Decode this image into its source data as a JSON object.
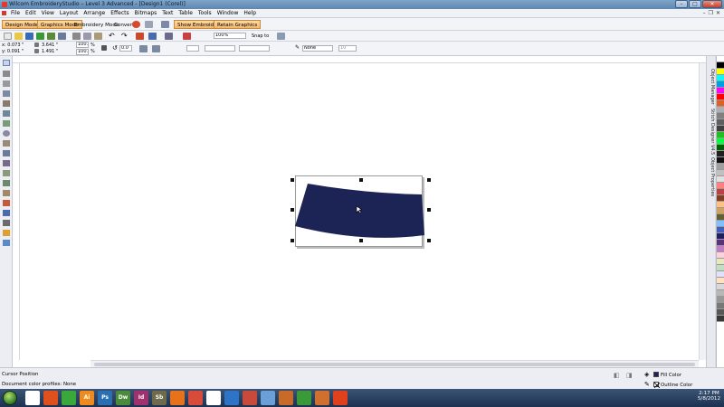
{
  "window": {
    "title": "Wilcom EmbroideryStudio – Level 3 Advanced - [Design1 (Corel)]"
  },
  "menu": {
    "items": [
      "File",
      "Edit",
      "View",
      "Layout",
      "Arrange",
      "Effects",
      "Bitmaps",
      "Text",
      "Table",
      "Tools",
      "Window",
      "Help"
    ]
  },
  "toolbar": {
    "design_mode": "Design Mode",
    "graphics_mode": "Graphics Mode",
    "embroidery_mode": "Embroidery Mode",
    "convert": "Convert",
    "show_embroidery": "Show Embroidery",
    "retain_graphics": "Retain Graphics"
  },
  "standard_toolbar": {
    "zoom": "100%",
    "snap_to": "Snap to"
  },
  "property_bar": {
    "x": "x: 0.073 \"",
    "y": "y: 0.091 \"",
    "width": "3.641 \"",
    "height": "1.491 \"",
    "scale_x": "100.0",
    "scale_y": "100.0",
    "percent": "%",
    "angle": "0.0",
    "outline": "None",
    "outline_size": "10"
  },
  "docker": {
    "tab1": "Object Manager",
    "tab2": "Stitch Designer V4.5",
    "tab3": "Object Properties"
  },
  "palette_colors": [
    "#ffffff",
    "#000000",
    "#ffff00",
    "#00ffff",
    "#00a0e0",
    "#ff00ff",
    "#ff0000",
    "#e06020",
    "#b0b0b0",
    "#808080",
    "#606060",
    "#404040",
    "#20c020",
    "#00ff40",
    "#006000",
    "#202020",
    "#101010",
    "#a0a0a0",
    "#c0c0c0",
    "#e0e0e0",
    "#ff8080",
    "#c04040",
    "#804020",
    "#ffc080",
    "#d0a060",
    "#606030",
    "#80c0ff",
    "#4060c0",
    "#202060",
    "#603080",
    "#c080c0",
    "#ffd0e0",
    "#e8e8c0",
    "#c0e0c0",
    "#e0e0ff",
    "#ffe0c0",
    "#d8d8d8",
    "#b8b8b8",
    "#989898",
    "#787878",
    "#585858",
    "#383838"
  ],
  "design": {
    "fill_color": "#1c2456"
  },
  "status": {
    "cursor_position": "Cursor Position",
    "color_profiles": "Document color profiles: None",
    "fill_label": "Fill Color",
    "outline_label": "Outline Color"
  },
  "taskbar": {
    "apps": [
      {
        "icon": "wilcom-icon",
        "color": "#ffffff",
        "text": ""
      },
      {
        "icon": "fire-icon",
        "color": "#e0501c",
        "text": ""
      },
      {
        "icon": "corel-icon",
        "color": "#3aa83a",
        "text": ""
      },
      {
        "icon": "illustrator-icon",
        "color": "#f08a1c",
        "text": "Ai"
      },
      {
        "icon": "photoshop-icon",
        "color": "#2b6fb3",
        "text": "Ps"
      },
      {
        "icon": "dreamweaver-icon",
        "color": "#4a8c3a",
        "text": "Dw"
      },
      {
        "icon": "indesign-icon",
        "color": "#a0306e",
        "text": "Id"
      },
      {
        "icon": "soundbooth-icon",
        "color": "#6e6a4a",
        "text": "Sb"
      },
      {
        "icon": "firefox-icon",
        "color": "#e6721c",
        "text": ""
      },
      {
        "icon": "chrome-icon",
        "color": "#d84a3a",
        "text": ""
      },
      {
        "icon": "word-icon",
        "color": "#ffffff",
        "text": ""
      },
      {
        "icon": "network-icon",
        "color": "#2e74c6",
        "text": ""
      },
      {
        "icon": "game-icon",
        "color": "#c84a3a",
        "text": ""
      },
      {
        "icon": "globe-icon",
        "color": "#6aa0d8",
        "text": ""
      },
      {
        "icon": "tools-icon",
        "color": "#c86a2a",
        "text": ""
      },
      {
        "icon": "wilcom-app-icon",
        "color": "#3a9a3a",
        "text": ""
      },
      {
        "icon": "player-icon",
        "color": "#d07030",
        "text": ""
      },
      {
        "icon": "flame-icon",
        "color": "#e0401c",
        "text": ""
      }
    ],
    "time": "2:17 PM",
    "date": "5/8/2012"
  }
}
